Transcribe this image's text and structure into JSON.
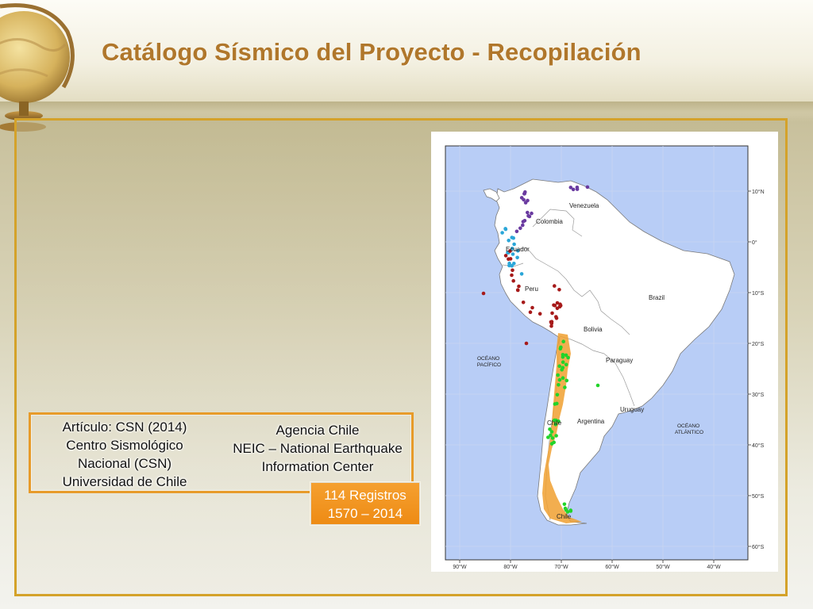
{
  "slide": {
    "title": "Catálogo Sísmico del Proyecto - Recopilación"
  },
  "sources": {
    "left": [
      "Artículo: CSN (2014)",
      "Centro Sismológico",
      "Nacional (CSN)",
      "Universidad de Chile"
    ],
    "right": [
      "Agencia Chile",
      "NEIC – National Earthquake",
      "Information Center"
    ]
  },
  "records": {
    "line1": "114 Registros",
    "line2": "1570 – 2014"
  },
  "map": {
    "ocean_color": "#b8cdf6",
    "land_color": "#ffffff",
    "lat_labels": [
      "10°N",
      "0°",
      "10°S",
      "20°S",
      "30°S",
      "40°S",
      "50°S",
      "60°S"
    ],
    "lon_labels": [
      "90°W",
      "80°W",
      "70°W",
      "60°W",
      "50°W",
      "40°W"
    ],
    "countries": {
      "venezuela": "Venezuela",
      "colombia": "Colombia",
      "ecuador": "Ecuador",
      "peru": "Peru",
      "brazil": "Brazil",
      "bolivia": "Bolivia",
      "paraguay": "Paraguay",
      "uruguay": "Uruguay",
      "argentina": "Argentina",
      "chile_north": "Chile",
      "chile_south": "Chile"
    },
    "oceans": {
      "pacific": [
        "OCÉANO",
        "PACÍFICO"
      ],
      "atlantic": [
        "OCÉANO",
        "ATLÁNTICO"
      ]
    },
    "point_colors": {
      "north": "#6a3aa0",
      "ecuador": "#2aa6d8",
      "peru": "#a61a1a",
      "chile": "#22d42a",
      "chile_zone": "#f0a030"
    }
  }
}
